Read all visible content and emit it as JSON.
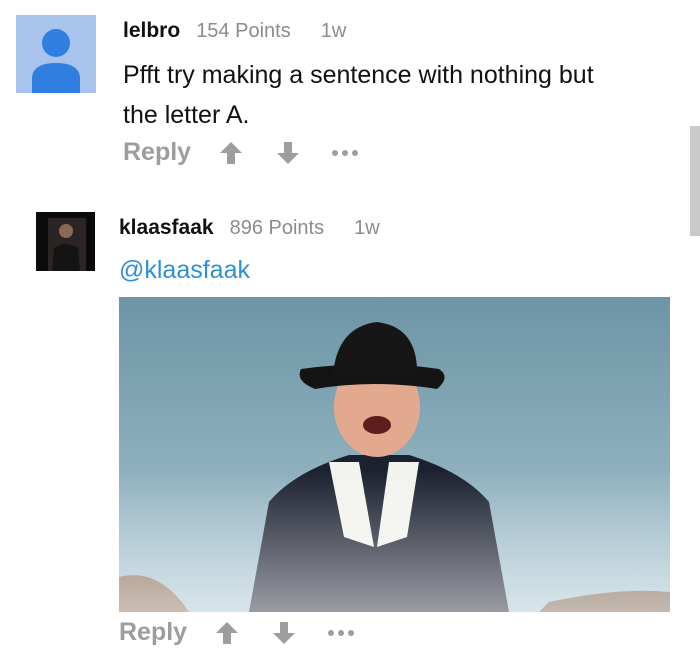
{
  "comments": [
    {
      "username": "lelbro",
      "points": "154 Points",
      "age": "1w",
      "text_line1": "Pfft try making a sentence with nothing but",
      "text_line2": "the letter A.",
      "reply_label": "Reply"
    },
    {
      "username": "klaasfaak",
      "points": "896 Points",
      "age": "1w",
      "mention": "@klaasfaak",
      "reply_label": "Reply"
    }
  ],
  "icons": {
    "upvote": "arrow-up-icon",
    "downvote": "arrow-down-icon",
    "more": "more-dots-icon",
    "default_avatar": "user-silhouette-icon"
  },
  "colors": {
    "mention": "#2e8fd6",
    "muted_text": "#8c8c8c",
    "action_gray": "#9d9d9d",
    "avatar_bg": "#a8c4ec",
    "avatar_figure": "#2f7ee0"
  }
}
